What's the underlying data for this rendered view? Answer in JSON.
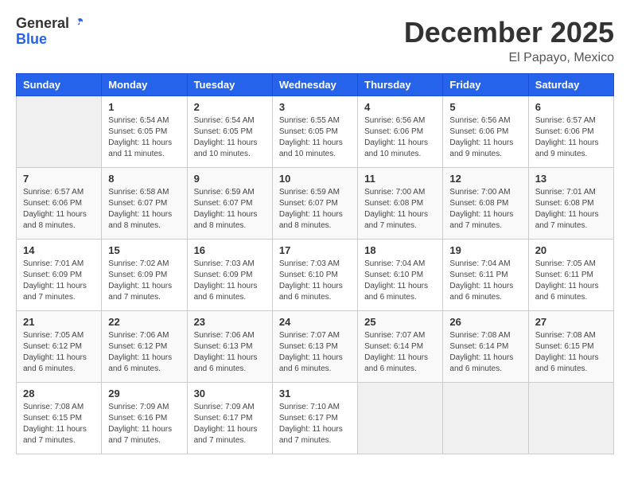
{
  "header": {
    "logo_general": "General",
    "logo_blue": "Blue",
    "month_year": "December 2025",
    "location": "El Papayo, Mexico"
  },
  "weekdays": [
    "Sunday",
    "Monday",
    "Tuesday",
    "Wednesday",
    "Thursday",
    "Friday",
    "Saturday"
  ],
  "weeks": [
    [
      {
        "day": "",
        "info": ""
      },
      {
        "day": "1",
        "info": "Sunrise: 6:54 AM\nSunset: 6:05 PM\nDaylight: 11 hours\nand 11 minutes."
      },
      {
        "day": "2",
        "info": "Sunrise: 6:54 AM\nSunset: 6:05 PM\nDaylight: 11 hours\nand 10 minutes."
      },
      {
        "day": "3",
        "info": "Sunrise: 6:55 AM\nSunset: 6:05 PM\nDaylight: 11 hours\nand 10 minutes."
      },
      {
        "day": "4",
        "info": "Sunrise: 6:56 AM\nSunset: 6:06 PM\nDaylight: 11 hours\nand 10 minutes."
      },
      {
        "day": "5",
        "info": "Sunrise: 6:56 AM\nSunset: 6:06 PM\nDaylight: 11 hours\nand 9 minutes."
      },
      {
        "day": "6",
        "info": "Sunrise: 6:57 AM\nSunset: 6:06 PM\nDaylight: 11 hours\nand 9 minutes."
      }
    ],
    [
      {
        "day": "7",
        "info": "Sunrise: 6:57 AM\nSunset: 6:06 PM\nDaylight: 11 hours\nand 8 minutes."
      },
      {
        "day": "8",
        "info": "Sunrise: 6:58 AM\nSunset: 6:07 PM\nDaylight: 11 hours\nand 8 minutes."
      },
      {
        "day": "9",
        "info": "Sunrise: 6:59 AM\nSunset: 6:07 PM\nDaylight: 11 hours\nand 8 minutes."
      },
      {
        "day": "10",
        "info": "Sunrise: 6:59 AM\nSunset: 6:07 PM\nDaylight: 11 hours\nand 8 minutes."
      },
      {
        "day": "11",
        "info": "Sunrise: 7:00 AM\nSunset: 6:08 PM\nDaylight: 11 hours\nand 7 minutes."
      },
      {
        "day": "12",
        "info": "Sunrise: 7:00 AM\nSunset: 6:08 PM\nDaylight: 11 hours\nand 7 minutes."
      },
      {
        "day": "13",
        "info": "Sunrise: 7:01 AM\nSunset: 6:08 PM\nDaylight: 11 hours\nand 7 minutes."
      }
    ],
    [
      {
        "day": "14",
        "info": "Sunrise: 7:01 AM\nSunset: 6:09 PM\nDaylight: 11 hours\nand 7 minutes."
      },
      {
        "day": "15",
        "info": "Sunrise: 7:02 AM\nSunset: 6:09 PM\nDaylight: 11 hours\nand 7 minutes."
      },
      {
        "day": "16",
        "info": "Sunrise: 7:03 AM\nSunset: 6:09 PM\nDaylight: 11 hours\nand 6 minutes."
      },
      {
        "day": "17",
        "info": "Sunrise: 7:03 AM\nSunset: 6:10 PM\nDaylight: 11 hours\nand 6 minutes."
      },
      {
        "day": "18",
        "info": "Sunrise: 7:04 AM\nSunset: 6:10 PM\nDaylight: 11 hours\nand 6 minutes."
      },
      {
        "day": "19",
        "info": "Sunrise: 7:04 AM\nSunset: 6:11 PM\nDaylight: 11 hours\nand 6 minutes."
      },
      {
        "day": "20",
        "info": "Sunrise: 7:05 AM\nSunset: 6:11 PM\nDaylight: 11 hours\nand 6 minutes."
      }
    ],
    [
      {
        "day": "21",
        "info": "Sunrise: 7:05 AM\nSunset: 6:12 PM\nDaylight: 11 hours\nand 6 minutes."
      },
      {
        "day": "22",
        "info": "Sunrise: 7:06 AM\nSunset: 6:12 PM\nDaylight: 11 hours\nand 6 minutes."
      },
      {
        "day": "23",
        "info": "Sunrise: 7:06 AM\nSunset: 6:13 PM\nDaylight: 11 hours\nand 6 minutes."
      },
      {
        "day": "24",
        "info": "Sunrise: 7:07 AM\nSunset: 6:13 PM\nDaylight: 11 hours\nand 6 minutes."
      },
      {
        "day": "25",
        "info": "Sunrise: 7:07 AM\nSunset: 6:14 PM\nDaylight: 11 hours\nand 6 minutes."
      },
      {
        "day": "26",
        "info": "Sunrise: 7:08 AM\nSunset: 6:14 PM\nDaylight: 11 hours\nand 6 minutes."
      },
      {
        "day": "27",
        "info": "Sunrise: 7:08 AM\nSunset: 6:15 PM\nDaylight: 11 hours\nand 6 minutes."
      }
    ],
    [
      {
        "day": "28",
        "info": "Sunrise: 7:08 AM\nSunset: 6:15 PM\nDaylight: 11 hours\nand 7 minutes."
      },
      {
        "day": "29",
        "info": "Sunrise: 7:09 AM\nSunset: 6:16 PM\nDaylight: 11 hours\nand 7 minutes."
      },
      {
        "day": "30",
        "info": "Sunrise: 7:09 AM\nSunset: 6:17 PM\nDaylight: 11 hours\nand 7 minutes."
      },
      {
        "day": "31",
        "info": "Sunrise: 7:10 AM\nSunset: 6:17 PM\nDaylight: 11 hours\nand 7 minutes."
      },
      {
        "day": "",
        "info": ""
      },
      {
        "day": "",
        "info": ""
      },
      {
        "day": "",
        "info": ""
      }
    ]
  ]
}
